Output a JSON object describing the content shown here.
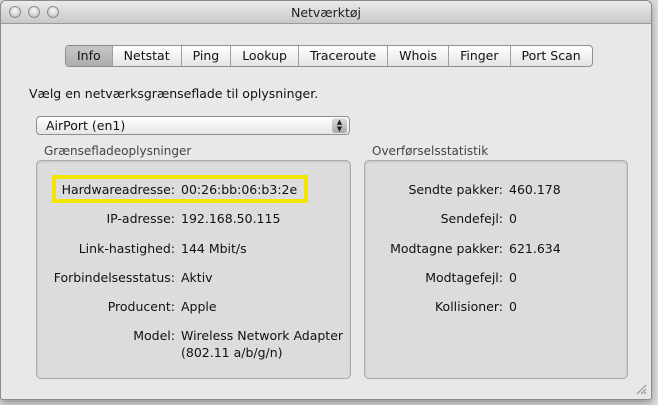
{
  "window": {
    "title": "Netværktøj"
  },
  "tabs": [
    {
      "label": "Info",
      "selected": true
    },
    {
      "label": "Netstat",
      "selected": false
    },
    {
      "label": "Ping",
      "selected": false
    },
    {
      "label": "Lookup",
      "selected": false
    },
    {
      "label": "Traceroute",
      "selected": false
    },
    {
      "label": "Whois",
      "selected": false
    },
    {
      "label": "Finger",
      "selected": false
    },
    {
      "label": "Port Scan",
      "selected": false
    }
  ],
  "instruction": "Vælg en netværksgrænseflade til oplysninger.",
  "interface_popup": {
    "selected": "AirPort (en1)"
  },
  "interface_info": {
    "title": "Grænsefladeoplysninger",
    "hardware": {
      "label": "Hardwareadresse:",
      "value": "00:26:bb:06:b3:2e"
    },
    "ip": {
      "label": "IP-adresse:",
      "value": "192.168.50.115"
    },
    "link_speed": {
      "label": "Link-hastighed:",
      "value": "144 Mbit/s"
    },
    "status": {
      "label": "Forbindelsesstatus:",
      "value": "Aktiv"
    },
    "vendor": {
      "label": "Producent:",
      "value": "Apple"
    },
    "model": {
      "label": "Model:",
      "value_line1": "Wireless Network Adapter",
      "value_line2": "(802.11 a/b/g/n)"
    }
  },
  "transfer_stats": {
    "title": "Overførselsstatistik",
    "sent_packets": {
      "label": "Sendte pakker:",
      "value": "460.178"
    },
    "send_errors": {
      "label": "Sendefejl:",
      "value": "0"
    },
    "recv_packets": {
      "label": "Modtagne pakker:",
      "value": "621.634"
    },
    "recv_errors": {
      "label": "Modtagefejl:",
      "value": "0"
    },
    "collisions": {
      "label": "Kollisioner:",
      "value": "0"
    }
  },
  "colors": {
    "highlight": "#f2e500"
  }
}
